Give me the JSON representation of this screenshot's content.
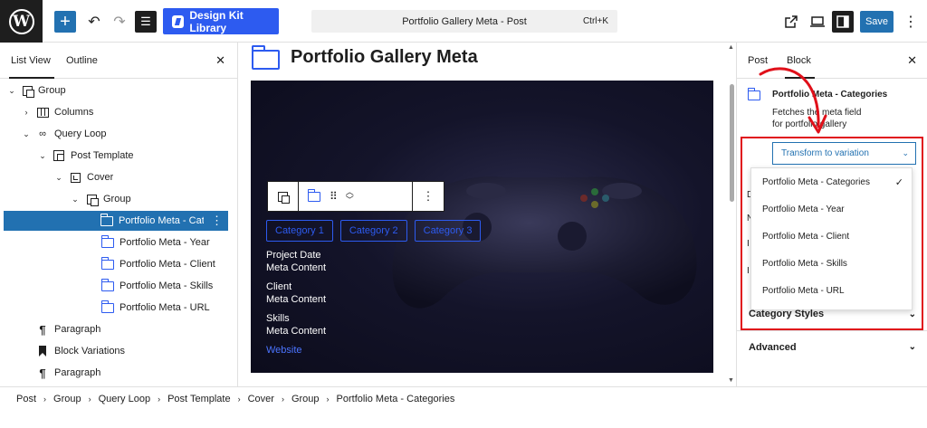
{
  "topbar": {
    "design_kit_label": "Design Kit Library",
    "command_title": "Portfolio Gallery Meta - Post",
    "command_shortcut": "Ctrl+K",
    "save_label": "Save"
  },
  "list_view": {
    "tabs": [
      "List View",
      "Outline"
    ],
    "items": [
      {
        "label": "Group"
      },
      {
        "label": "Columns"
      },
      {
        "label": "Query Loop"
      },
      {
        "label": "Post Template"
      },
      {
        "label": "Cover"
      },
      {
        "label": "Group"
      },
      {
        "label": "Portfolio Meta - Categories"
      },
      {
        "label": "Portfolio Meta - Year"
      },
      {
        "label": "Portfolio Meta - Client"
      },
      {
        "label": "Portfolio Meta - Skills"
      },
      {
        "label": "Portfolio Meta - URL"
      },
      {
        "label": "Paragraph"
      },
      {
        "label": "Block Variations"
      },
      {
        "label": "Paragraph"
      }
    ]
  },
  "canvas": {
    "post_title": "Portfolio Gallery Meta",
    "chips": [
      "Category 1",
      "Category 2",
      "Category 3"
    ],
    "meta": {
      "project_date_label": "Project Date",
      "project_date_value": "Meta Content",
      "client_label": "Client",
      "client_value": "Meta Content",
      "skills_label": "Skills",
      "skills_value": "Meta Content",
      "website_link": "Website"
    }
  },
  "settings": {
    "tabs": [
      "Post",
      "Block"
    ],
    "block_title": "Portfolio Meta - Categories",
    "block_description": "Fetches the meta field for portfolio gallery",
    "variation_select": "Transform to variation",
    "variations": [
      {
        "label": "Portfolio Meta - Categories",
        "selected": true
      },
      {
        "label": "Portfolio Meta - Year",
        "selected": false
      },
      {
        "label": "Portfolio Meta - Client",
        "selected": false
      },
      {
        "label": "Portfolio Meta - Skills",
        "selected": false
      },
      {
        "label": "Portfolio Meta - URL",
        "selected": false
      }
    ],
    "check_mark": "✓",
    "panels": [
      "Category Styles",
      "Advanced"
    ],
    "accent_red": "#e0101a",
    "accent_blue": "#2271b1"
  },
  "breadcrumb": [
    "Post",
    "Group",
    "Query Loop",
    "Post Template",
    "Cover",
    "Group",
    "Portfolio Meta - Categories"
  ]
}
